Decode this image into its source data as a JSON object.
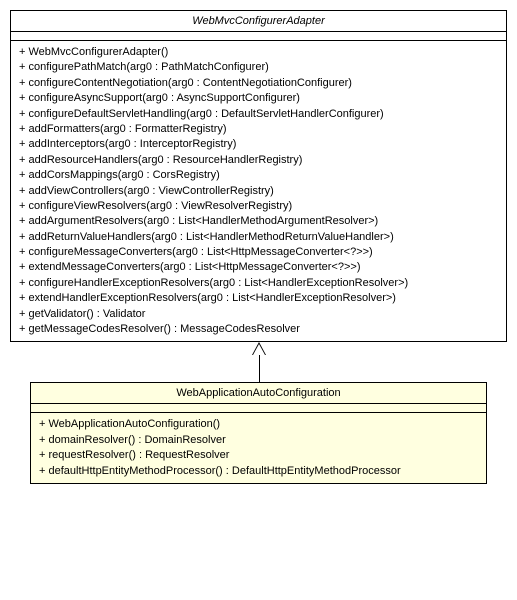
{
  "parent": {
    "name": "WebMvcConfigurerAdapter",
    "methods": [
      "+ WebMvcConfigurerAdapter()",
      "+ configurePathMatch(arg0 : PathMatchConfigurer)",
      "+ configureContentNegotiation(arg0 : ContentNegotiationConfigurer)",
      "+ configureAsyncSupport(arg0 : AsyncSupportConfigurer)",
      "+ configureDefaultServletHandling(arg0 : DefaultServletHandlerConfigurer)",
      "+ addFormatters(arg0 : FormatterRegistry)",
      "+ addInterceptors(arg0 : InterceptorRegistry)",
      "+ addResourceHandlers(arg0 : ResourceHandlerRegistry)",
      "+ addCorsMappings(arg0 : CorsRegistry)",
      "+ addViewControllers(arg0 : ViewControllerRegistry)",
      "+ configureViewResolvers(arg0 : ViewResolverRegistry)",
      "+ addArgumentResolvers(arg0 : List<HandlerMethodArgumentResolver>)",
      "+ addReturnValueHandlers(arg0 : List<HandlerMethodReturnValueHandler>)",
      "+ configureMessageConverters(arg0 : List<HttpMessageConverter<?>>)",
      "+ extendMessageConverters(arg0 : List<HttpMessageConverter<?>>)",
      "+ configureHandlerExceptionResolvers(arg0 : List<HandlerExceptionResolver>)",
      "+ extendHandlerExceptionResolvers(arg0 : List<HandlerExceptionResolver>)",
      "+ getValidator() : Validator",
      "+ getMessageCodesResolver() : MessageCodesResolver"
    ]
  },
  "child": {
    "name": "WebApplicationAutoConfiguration",
    "methods": [
      "+ WebApplicationAutoConfiguration()",
      "+ domainResolver() : DomainResolver",
      "+ requestResolver() : RequestResolver",
      "+ defaultHttpEntityMethodProcessor() : DefaultHttpEntityMethodProcessor"
    ]
  }
}
